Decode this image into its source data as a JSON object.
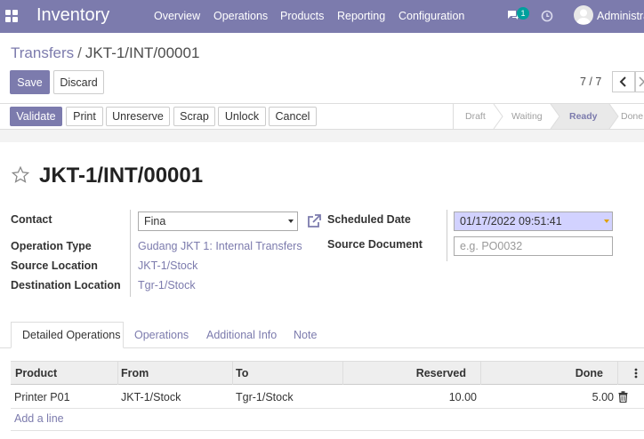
{
  "navbar": {
    "app_name": "Inventory",
    "menu": [
      "Overview",
      "Operations",
      "Products",
      "Reporting",
      "Configuration"
    ],
    "message_count": "1",
    "user_name": "Administra"
  },
  "breadcrumb": {
    "parent": "Transfers",
    "separator": "/",
    "current": "JKT-1/INT/00001"
  },
  "actions": {
    "save": "Save",
    "discard": "Discard"
  },
  "pager": {
    "value": "7 / 7"
  },
  "header_buttons": [
    "Validate",
    "Print",
    "Unreserve",
    "Scrap",
    "Unlock",
    "Cancel"
  ],
  "statusbar": {
    "stages": [
      "Draft",
      "Waiting",
      "Ready",
      "Done"
    ],
    "active": "Ready"
  },
  "record": {
    "title": "JKT-1/INT/00001"
  },
  "fields": {
    "contact_label": "Contact",
    "contact_value": "Fina",
    "operation_type_label": "Operation Type",
    "operation_type_value": "Gudang JKT 1: Internal Transfers",
    "source_location_label": "Source Location",
    "source_location_value": "JKT-1/Stock",
    "destination_location_label": "Destination Location",
    "destination_location_value": "Tgr-1/Stock",
    "scheduled_date_label": "Scheduled Date",
    "scheduled_date_value": "01/17/2022 09:51:41",
    "source_document_label": "Source Document",
    "source_document_placeholder": "e.g. PO0032"
  },
  "tabs": [
    "Detailed Operations",
    "Operations",
    "Additional Info",
    "Note"
  ],
  "table": {
    "columns": [
      "Product",
      "From",
      "To",
      "Reserved",
      "Done"
    ],
    "rows": [
      {
        "product": "Printer P01",
        "from": "JKT-1/Stock",
        "to": "Tgr-1/Stock",
        "reserved": "10.00",
        "done": "5.00"
      }
    ],
    "add_line": "Add a line"
  },
  "colors": {
    "brand": "#7c7bad",
    "required_field": "#d2d2ff",
    "badge": "#00a09d"
  }
}
